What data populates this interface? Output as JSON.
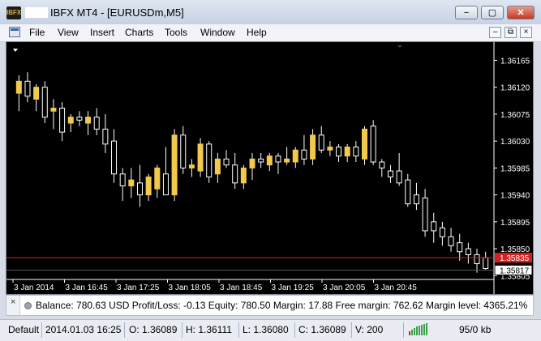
{
  "window": {
    "app_logo": "IBFX",
    "title": "IBFX MT4 - [EURUSDm,M5]",
    "minimize": "−",
    "maximize": "▢",
    "close": "✕"
  },
  "menu": {
    "items": [
      "File",
      "View",
      "Insert",
      "Charts",
      "Tools",
      "Window",
      "Help"
    ],
    "mdi_minimize": "–",
    "mdi_restore": "⧉",
    "mdi_close": "×"
  },
  "chart_data": {
    "type": "candlestick",
    "symbol": "EURUSDm",
    "timeframe": "M5",
    "y_ticks": [
      "1.36165",
      "1.36120",
      "1.36075",
      "1.36030",
      "1.35985",
      "1.35940",
      "1.35895",
      "1.35850",
      "1.35805"
    ],
    "x_ticks": [
      "3 Jan 2014",
      "3 Jan 16:45",
      "3 Jan 17:25",
      "3 Jan 18:05",
      "3 Jan 18:45",
      "3 Jan 19:25",
      "3 Jan 20:05",
      "3 Jan 20:45"
    ],
    "ylim": [
      1.358,
      1.3619
    ],
    "bid_label": "1.35835",
    "last_label": "1.35817",
    "colors": {
      "background": "#000000",
      "bull": "#f2c94c",
      "bear": "#ffffff",
      "grid": "#1a1a1a",
      "bid_line": "#d42020"
    },
    "candles": [
      {
        "o": 1.3611,
        "h": 1.3614,
        "l": 1.3608,
        "c": 1.3613
      },
      {
        "o": 1.3613,
        "h": 1.36145,
        "l": 1.36095,
        "c": 1.36105
      },
      {
        "o": 1.361,
        "h": 1.36125,
        "l": 1.3608,
        "c": 1.3612
      },
      {
        "o": 1.3612,
        "h": 1.3613,
        "l": 1.3606,
        "c": 1.3607
      },
      {
        "o": 1.3608,
        "h": 1.361,
        "l": 1.3605,
        "c": 1.36085
      },
      {
        "o": 1.36085,
        "h": 1.36095,
        "l": 1.3603,
        "c": 1.36045
      },
      {
        "o": 1.3606,
        "h": 1.36075,
        "l": 1.36045,
        "c": 1.3607
      },
      {
        "o": 1.3607,
        "h": 1.3608,
        "l": 1.36055,
        "c": 1.36065
      },
      {
        "o": 1.3606,
        "h": 1.3608,
        "l": 1.3604,
        "c": 1.3607
      },
      {
        "o": 1.3607,
        "h": 1.36085,
        "l": 1.3604,
        "c": 1.3605
      },
      {
        "o": 1.3605,
        "h": 1.36075,
        "l": 1.3601,
        "c": 1.36025
      },
      {
        "o": 1.3603,
        "h": 1.3605,
        "l": 1.3596,
        "c": 1.35975
      },
      {
        "o": 1.35975,
        "h": 1.35985,
        "l": 1.3593,
        "c": 1.35955
      },
      {
        "o": 1.35955,
        "h": 1.35985,
        "l": 1.35935,
        "c": 1.35965
      },
      {
        "o": 1.3596,
        "h": 1.3599,
        "l": 1.3592,
        "c": 1.3594
      },
      {
        "o": 1.3594,
        "h": 1.35975,
        "l": 1.3593,
        "c": 1.3597
      },
      {
        "o": 1.3595,
        "h": 1.3599,
        "l": 1.35935,
        "c": 1.35985
      },
      {
        "o": 1.35975,
        "h": 1.3602,
        "l": 1.3594,
        "c": 1.3594
      },
      {
        "o": 1.3594,
        "h": 1.3605,
        "l": 1.3593,
        "c": 1.3604
      },
      {
        "o": 1.3604,
        "h": 1.36055,
        "l": 1.35975,
        "c": 1.35985
      },
      {
        "o": 1.35985,
        "h": 1.36,
        "l": 1.3597,
        "c": 1.3599
      },
      {
        "o": 1.3598,
        "h": 1.36035,
        "l": 1.3597,
        "c": 1.36025
      },
      {
        "o": 1.36025,
        "h": 1.3603,
        "l": 1.3596,
        "c": 1.3597
      },
      {
        "o": 1.35975,
        "h": 1.3601,
        "l": 1.3596,
        "c": 1.36
      },
      {
        "o": 1.36,
        "h": 1.36015,
        "l": 1.35985,
        "c": 1.3599
      },
      {
        "o": 1.3599,
        "h": 1.3601,
        "l": 1.3595,
        "c": 1.3596
      },
      {
        "o": 1.3596,
        "h": 1.3599,
        "l": 1.3595,
        "c": 1.35985
      },
      {
        "o": 1.35985,
        "h": 1.3601,
        "l": 1.35965,
        "c": 1.36
      },
      {
        "o": 1.36,
        "h": 1.3601,
        "l": 1.35985,
        "c": 1.35995
      },
      {
        "o": 1.3599,
        "h": 1.3601,
        "l": 1.3598,
        "c": 1.36005
      },
      {
        "o": 1.36005,
        "h": 1.3601,
        "l": 1.35975,
        "c": 1.35995
      },
      {
        "o": 1.35995,
        "h": 1.3602,
        "l": 1.3599,
        "c": 1.36
      },
      {
        "o": 1.35995,
        "h": 1.3602,
        "l": 1.35985,
        "c": 1.36015
      },
      {
        "o": 1.36015,
        "h": 1.3604,
        "l": 1.3599,
        "c": 1.36
      },
      {
        "o": 1.36,
        "h": 1.3605,
        "l": 1.3599,
        "c": 1.3604
      },
      {
        "o": 1.3604,
        "h": 1.36055,
        "l": 1.3601,
        "c": 1.36015
      },
      {
        "o": 1.36015,
        "h": 1.3603,
        "l": 1.36005,
        "c": 1.3602
      },
      {
        "o": 1.3602,
        "h": 1.36025,
        "l": 1.35995,
        "c": 1.36005
      },
      {
        "o": 1.36005,
        "h": 1.36025,
        "l": 1.35995,
        "c": 1.3602
      },
      {
        "o": 1.3602,
        "h": 1.3603,
        "l": 1.35995,
        "c": 1.36005
      },
      {
        "o": 1.36,
        "h": 1.36055,
        "l": 1.3599,
        "c": 1.3605
      },
      {
        "o": 1.36055,
        "h": 1.36065,
        "l": 1.3599,
        "c": 1.35995
      },
      {
        "o": 1.35995,
        "h": 1.36,
        "l": 1.3597,
        "c": 1.35985
      },
      {
        "o": 1.3598,
        "h": 1.3599,
        "l": 1.3596,
        "c": 1.3597
      },
      {
        "o": 1.3598,
        "h": 1.3601,
        "l": 1.35955,
        "c": 1.3596
      },
      {
        "o": 1.35965,
        "h": 1.35975,
        "l": 1.3592,
        "c": 1.35925
      },
      {
        "o": 1.3594,
        "h": 1.3596,
        "l": 1.35915,
        "c": 1.35925
      },
      {
        "o": 1.35935,
        "h": 1.3595,
        "l": 1.3587,
        "c": 1.3588
      },
      {
        "o": 1.35895,
        "h": 1.3591,
        "l": 1.3586,
        "c": 1.3588
      },
      {
        "o": 1.35885,
        "h": 1.35895,
        "l": 1.35855,
        "c": 1.3587
      },
      {
        "o": 1.3587,
        "h": 1.35885,
        "l": 1.35845,
        "c": 1.35855
      },
      {
        "o": 1.3586,
        "h": 1.35875,
        "l": 1.3583,
        "c": 1.35845
      },
      {
        "o": 1.3585,
        "h": 1.3586,
        "l": 1.35825,
        "c": 1.3584
      },
      {
        "o": 1.3584,
        "h": 1.3585,
        "l": 1.3581,
        "c": 1.35825
      },
      {
        "o": 1.35835,
        "h": 1.35845,
        "l": 1.35815,
        "c": 1.35817
      }
    ]
  },
  "account": {
    "close_icon": "×",
    "text": "Balance: 780.63 USD  Profit/Loss: -0.13  Equity: 780.50  Margin: 17.88  Free margin: 762.62  Margin level: 4365.21%"
  },
  "status": {
    "profile": "Default",
    "datetime": "2014.01.03 16:25",
    "open": "O: 1.36089",
    "high": "H: 1.36111",
    "low": "L: 1.36080",
    "close": "C: 1.36089",
    "volume": "V: 200",
    "traffic": "95/0 kb"
  }
}
